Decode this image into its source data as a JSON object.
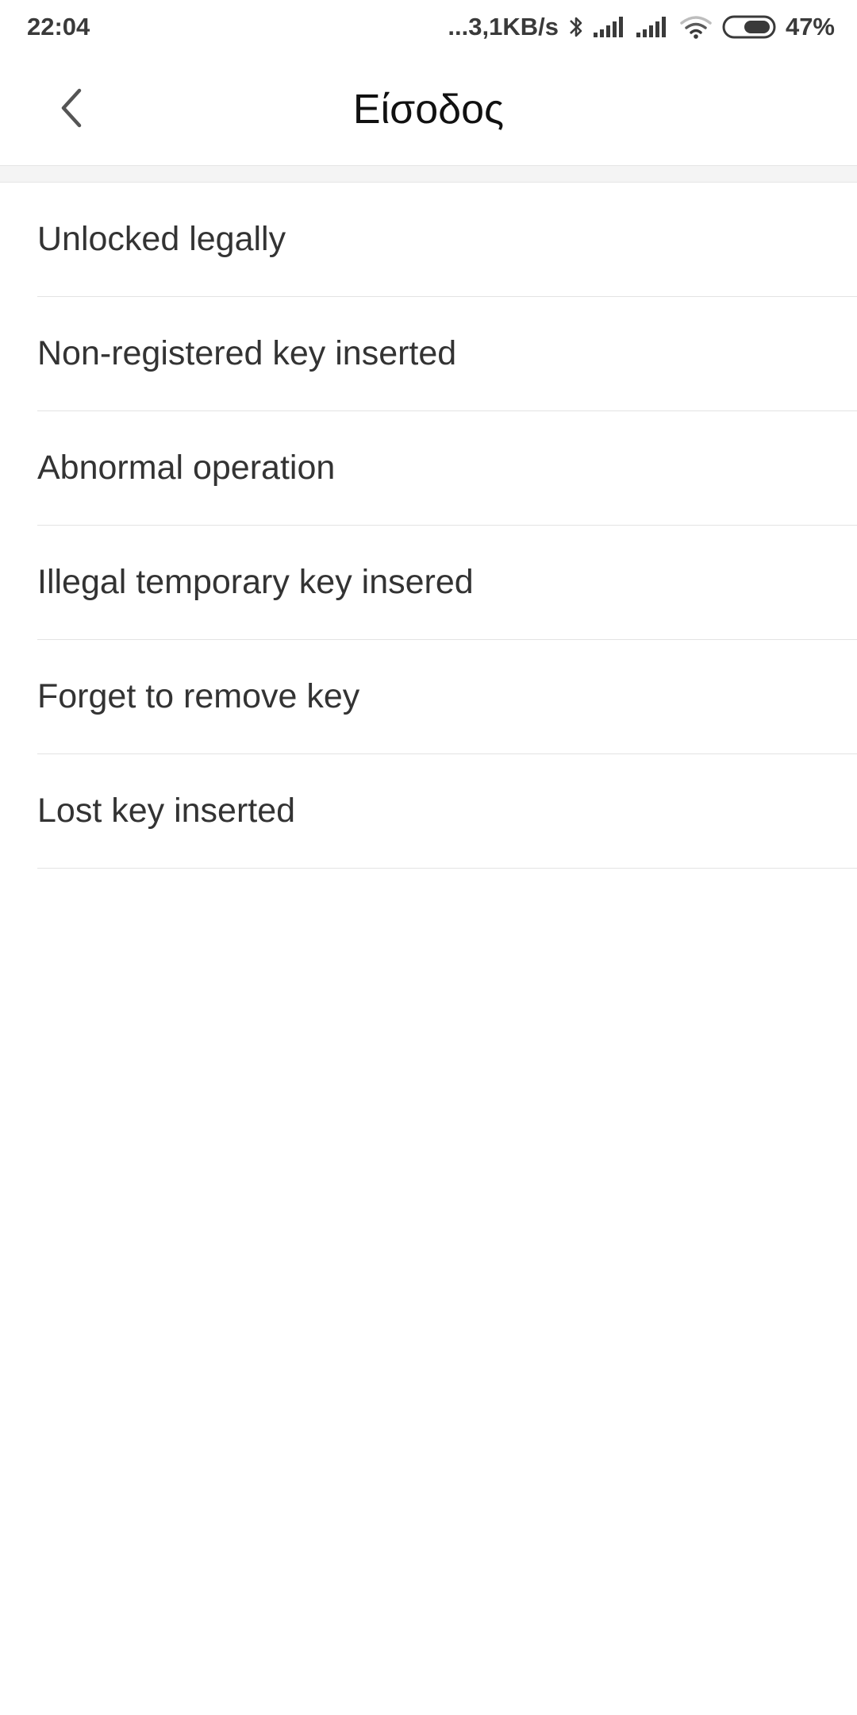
{
  "status_bar": {
    "time": "22:04",
    "network_speed": "...3,1KB/s",
    "battery": "47%",
    "icons": [
      "bluetooth-icon",
      "signal-icon",
      "signal-icon",
      "wifi-icon",
      "battery-icon"
    ]
  },
  "header": {
    "title": "Είσοδος",
    "back_icon": "chevron-left-icon"
  },
  "list": {
    "items": [
      {
        "label": "Unlocked legally"
      },
      {
        "label": "Non-registered key inserted"
      },
      {
        "label": "Abnormal operation"
      },
      {
        "label": "Illegal temporary key insered"
      },
      {
        "label": "Forget to remove key"
      },
      {
        "label": "Lost key inserted"
      }
    ]
  }
}
